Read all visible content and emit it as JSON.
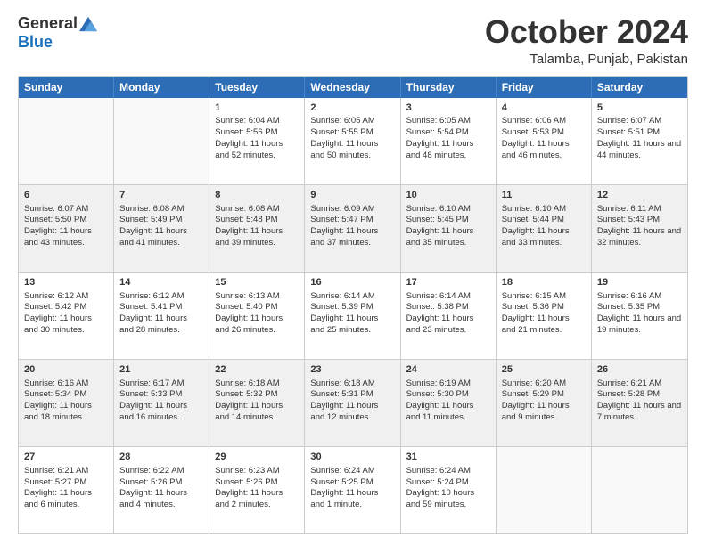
{
  "header": {
    "logo_general": "General",
    "logo_blue": "Blue",
    "month": "October 2024",
    "location": "Talamba, Punjab, Pakistan"
  },
  "days_of_week": [
    "Sunday",
    "Monday",
    "Tuesday",
    "Wednesday",
    "Thursday",
    "Friday",
    "Saturday"
  ],
  "rows": [
    [
      {
        "day": "",
        "sunrise": "",
        "sunset": "",
        "daylight": "",
        "empty": true
      },
      {
        "day": "",
        "sunrise": "",
        "sunset": "",
        "daylight": "",
        "empty": true
      },
      {
        "day": "1",
        "sunrise": "Sunrise: 6:04 AM",
        "sunset": "Sunset: 5:56 PM",
        "daylight": "Daylight: 11 hours and 52 minutes."
      },
      {
        "day": "2",
        "sunrise": "Sunrise: 6:05 AM",
        "sunset": "Sunset: 5:55 PM",
        "daylight": "Daylight: 11 hours and 50 minutes."
      },
      {
        "day": "3",
        "sunrise": "Sunrise: 6:05 AM",
        "sunset": "Sunset: 5:54 PM",
        "daylight": "Daylight: 11 hours and 48 minutes."
      },
      {
        "day": "4",
        "sunrise": "Sunrise: 6:06 AM",
        "sunset": "Sunset: 5:53 PM",
        "daylight": "Daylight: 11 hours and 46 minutes."
      },
      {
        "day": "5",
        "sunrise": "Sunrise: 6:07 AM",
        "sunset": "Sunset: 5:51 PM",
        "daylight": "Daylight: 11 hours and 44 minutes."
      }
    ],
    [
      {
        "day": "6",
        "sunrise": "Sunrise: 6:07 AM",
        "sunset": "Sunset: 5:50 PM",
        "daylight": "Daylight: 11 hours and 43 minutes."
      },
      {
        "day": "7",
        "sunrise": "Sunrise: 6:08 AM",
        "sunset": "Sunset: 5:49 PM",
        "daylight": "Daylight: 11 hours and 41 minutes."
      },
      {
        "day": "8",
        "sunrise": "Sunrise: 6:08 AM",
        "sunset": "Sunset: 5:48 PM",
        "daylight": "Daylight: 11 hours and 39 minutes."
      },
      {
        "day": "9",
        "sunrise": "Sunrise: 6:09 AM",
        "sunset": "Sunset: 5:47 PM",
        "daylight": "Daylight: 11 hours and 37 minutes."
      },
      {
        "day": "10",
        "sunrise": "Sunrise: 6:10 AM",
        "sunset": "Sunset: 5:45 PM",
        "daylight": "Daylight: 11 hours and 35 minutes."
      },
      {
        "day": "11",
        "sunrise": "Sunrise: 6:10 AM",
        "sunset": "Sunset: 5:44 PM",
        "daylight": "Daylight: 11 hours and 33 minutes."
      },
      {
        "day": "12",
        "sunrise": "Sunrise: 6:11 AM",
        "sunset": "Sunset: 5:43 PM",
        "daylight": "Daylight: 11 hours and 32 minutes."
      }
    ],
    [
      {
        "day": "13",
        "sunrise": "Sunrise: 6:12 AM",
        "sunset": "Sunset: 5:42 PM",
        "daylight": "Daylight: 11 hours and 30 minutes."
      },
      {
        "day": "14",
        "sunrise": "Sunrise: 6:12 AM",
        "sunset": "Sunset: 5:41 PM",
        "daylight": "Daylight: 11 hours and 28 minutes."
      },
      {
        "day": "15",
        "sunrise": "Sunrise: 6:13 AM",
        "sunset": "Sunset: 5:40 PM",
        "daylight": "Daylight: 11 hours and 26 minutes."
      },
      {
        "day": "16",
        "sunrise": "Sunrise: 6:14 AM",
        "sunset": "Sunset: 5:39 PM",
        "daylight": "Daylight: 11 hours and 25 minutes."
      },
      {
        "day": "17",
        "sunrise": "Sunrise: 6:14 AM",
        "sunset": "Sunset: 5:38 PM",
        "daylight": "Daylight: 11 hours and 23 minutes."
      },
      {
        "day": "18",
        "sunrise": "Sunrise: 6:15 AM",
        "sunset": "Sunset: 5:36 PM",
        "daylight": "Daylight: 11 hours and 21 minutes."
      },
      {
        "day": "19",
        "sunrise": "Sunrise: 6:16 AM",
        "sunset": "Sunset: 5:35 PM",
        "daylight": "Daylight: 11 hours and 19 minutes."
      }
    ],
    [
      {
        "day": "20",
        "sunrise": "Sunrise: 6:16 AM",
        "sunset": "Sunset: 5:34 PM",
        "daylight": "Daylight: 11 hours and 18 minutes."
      },
      {
        "day": "21",
        "sunrise": "Sunrise: 6:17 AM",
        "sunset": "Sunset: 5:33 PM",
        "daylight": "Daylight: 11 hours and 16 minutes."
      },
      {
        "day": "22",
        "sunrise": "Sunrise: 6:18 AM",
        "sunset": "Sunset: 5:32 PM",
        "daylight": "Daylight: 11 hours and 14 minutes."
      },
      {
        "day": "23",
        "sunrise": "Sunrise: 6:18 AM",
        "sunset": "Sunset: 5:31 PM",
        "daylight": "Daylight: 11 hours and 12 minutes."
      },
      {
        "day": "24",
        "sunrise": "Sunrise: 6:19 AM",
        "sunset": "Sunset: 5:30 PM",
        "daylight": "Daylight: 11 hours and 11 minutes."
      },
      {
        "day": "25",
        "sunrise": "Sunrise: 6:20 AM",
        "sunset": "Sunset: 5:29 PM",
        "daylight": "Daylight: 11 hours and 9 minutes."
      },
      {
        "day": "26",
        "sunrise": "Sunrise: 6:21 AM",
        "sunset": "Sunset: 5:28 PM",
        "daylight": "Daylight: 11 hours and 7 minutes."
      }
    ],
    [
      {
        "day": "27",
        "sunrise": "Sunrise: 6:21 AM",
        "sunset": "Sunset: 5:27 PM",
        "daylight": "Daylight: 11 hours and 6 minutes."
      },
      {
        "day": "28",
        "sunrise": "Sunrise: 6:22 AM",
        "sunset": "Sunset: 5:26 PM",
        "daylight": "Daylight: 11 hours and 4 minutes."
      },
      {
        "day": "29",
        "sunrise": "Sunrise: 6:23 AM",
        "sunset": "Sunset: 5:26 PM",
        "daylight": "Daylight: 11 hours and 2 minutes."
      },
      {
        "day": "30",
        "sunrise": "Sunrise: 6:24 AM",
        "sunset": "Sunset: 5:25 PM",
        "daylight": "Daylight: 11 hours and 1 minute."
      },
      {
        "day": "31",
        "sunrise": "Sunrise: 6:24 AM",
        "sunset": "Sunset: 5:24 PM",
        "daylight": "Daylight: 10 hours and 59 minutes."
      },
      {
        "day": "",
        "sunrise": "",
        "sunset": "",
        "daylight": "",
        "empty": true
      },
      {
        "day": "",
        "sunrise": "",
        "sunset": "",
        "daylight": "",
        "empty": true
      }
    ]
  ]
}
